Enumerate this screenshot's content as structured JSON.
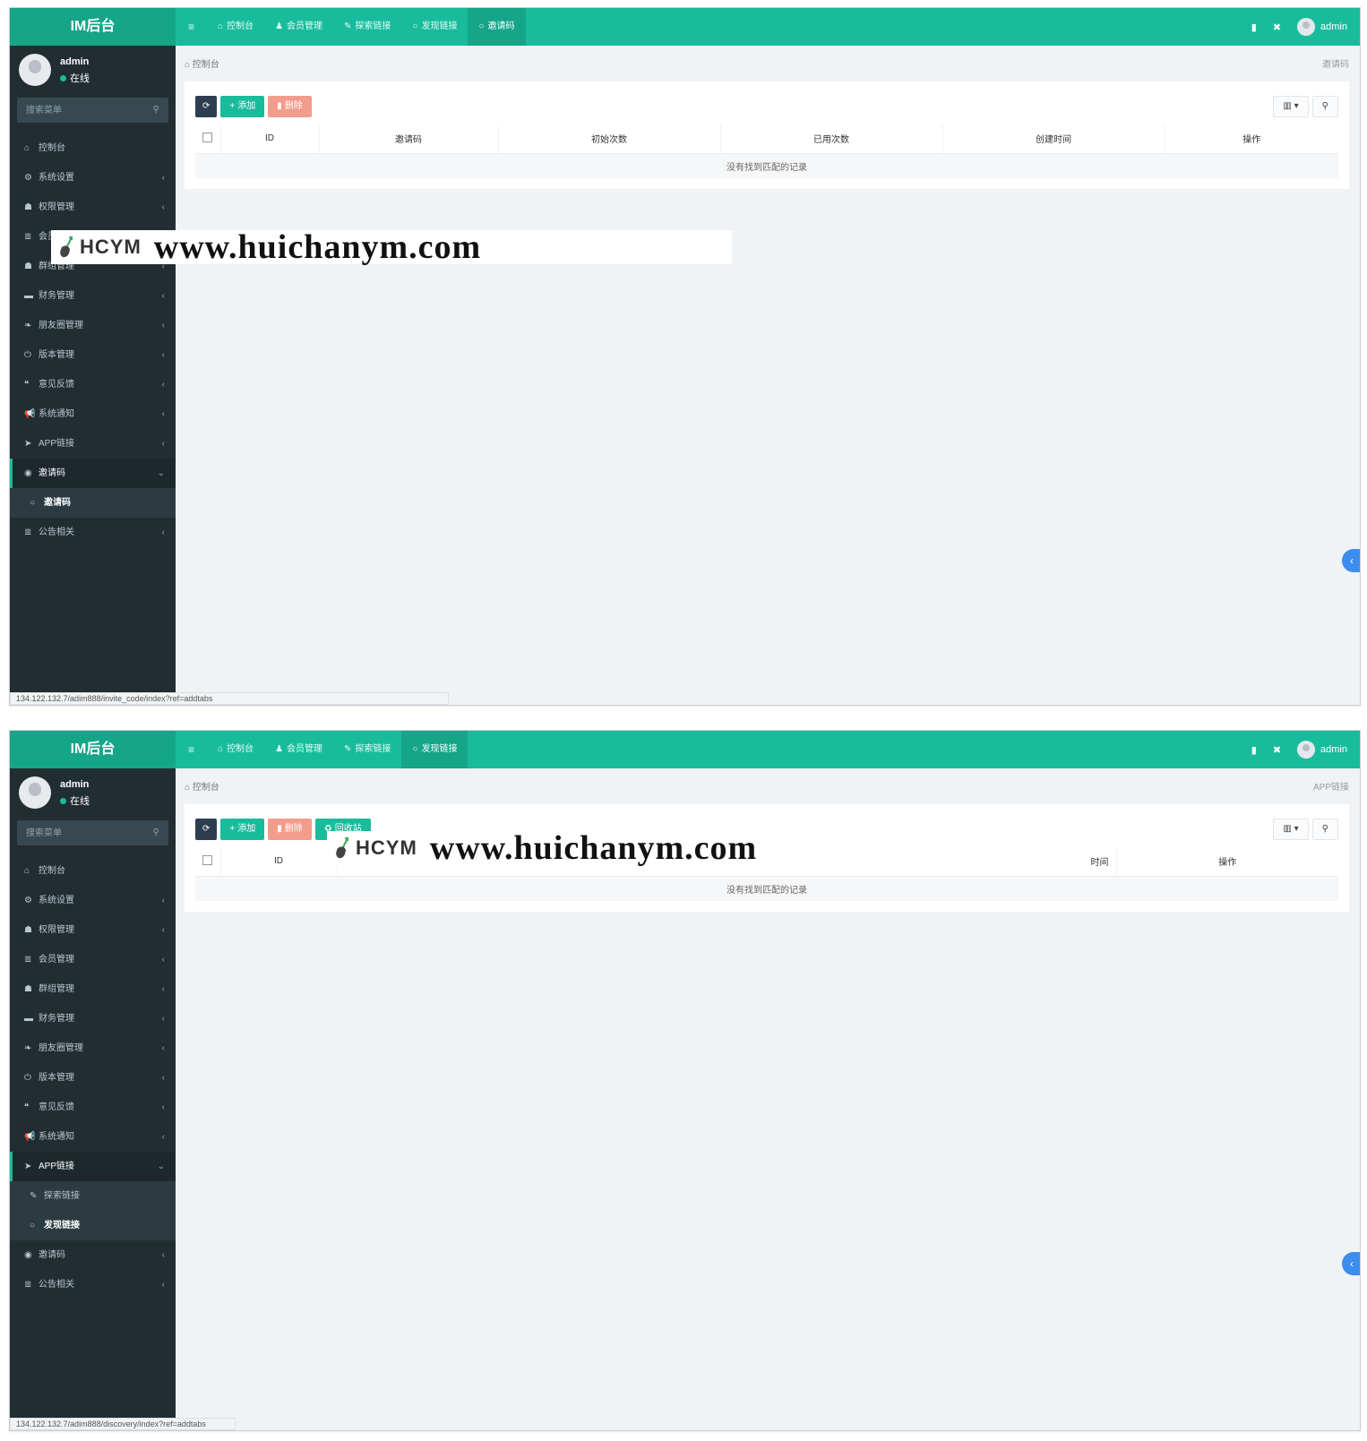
{
  "brand": {
    "title": "IM后台",
    "accent": "#18bc9c",
    "sidebar_bg": "#222d32"
  },
  "user": {
    "name": "admin",
    "status": "在线"
  },
  "search": {
    "placeholder": "搜索菜单"
  },
  "screen1": {
    "nav_tabs": [
      {
        "icon": "dashboard-icon",
        "label": "控制台"
      },
      {
        "icon": "user-icon",
        "label": "会员管理"
      },
      {
        "icon": "wrench-icon",
        "label": "探索链接"
      },
      {
        "icon": "circle-icon",
        "label": "发现链接"
      },
      {
        "icon": "circle-icon",
        "label": "邀请码"
      }
    ],
    "user_label": "admin",
    "crumb_left": "控制台",
    "crumb_right": "邀请码",
    "buttons": {
      "add": "添加",
      "delete": "删除"
    },
    "columns": [
      "ID",
      "邀请码",
      "初始次数",
      "已用次数",
      "创建时间",
      "操作"
    ],
    "empty_text": "没有找到匹配的记录",
    "menu": [
      {
        "icon": "dashboard-icon",
        "label": "控制台"
      },
      {
        "icon": "cogs-icon",
        "label": "系统设置",
        "arrow": "‹"
      },
      {
        "icon": "users-icon",
        "label": "权限管理",
        "arrow": "‹"
      },
      {
        "icon": "list-icon",
        "label": "会员管理",
        "arrow": "‹"
      },
      {
        "icon": "users-icon",
        "label": "群组管理",
        "arrow": "‹"
      },
      {
        "icon": "card-icon",
        "label": "财务管理",
        "arrow": "‹"
      },
      {
        "icon": "leaf-icon",
        "label": "朋友圈管理",
        "arrow": "‹"
      },
      {
        "icon": "power-icon",
        "label": "版本管理",
        "arrow": "‹"
      },
      {
        "icon": "quote-icon",
        "label": "意见反馈",
        "arrow": "‹"
      },
      {
        "icon": "bullhorn-icon",
        "label": "系统通知",
        "arrow": "‹"
      },
      {
        "icon": "send-icon",
        "label": "APP链接",
        "arrow": "‹"
      },
      {
        "icon": "eye-icon",
        "label": "邀请码",
        "arrow": "⌄"
      },
      {
        "icon": "circle-icon",
        "label": "邀请码"
      },
      {
        "icon": "list-icon",
        "label": "公告相关",
        "arrow": "‹"
      }
    ],
    "status_url": "134.122.132.7/adim888/invite_code/index?ref=addtabs"
  },
  "screen2": {
    "nav_tabs": [
      {
        "icon": "dashboard-icon",
        "label": "控制台"
      },
      {
        "icon": "user-icon",
        "label": "会员管理"
      },
      {
        "icon": "wrench-icon",
        "label": "探索链接"
      },
      {
        "icon": "circle-icon",
        "label": "发现链接"
      }
    ],
    "user_label": "admin",
    "crumb_left": "控制台",
    "crumb_right": "APP链接",
    "buttons": {
      "add": "添加",
      "delete": "删除",
      "recycle": "回收站"
    },
    "columns": [
      "ID",
      "时间",
      "操作"
    ],
    "empty_text": "没有找到匹配的记录",
    "menu": [
      {
        "icon": "dashboard-icon",
        "label": "控制台"
      },
      {
        "icon": "cogs-icon",
        "label": "系统设置",
        "arrow": "‹"
      },
      {
        "icon": "users-icon",
        "label": "权限管理",
        "arrow": "‹"
      },
      {
        "icon": "list-icon",
        "label": "会员管理",
        "arrow": "‹"
      },
      {
        "icon": "users-icon",
        "label": "群组管理",
        "arrow": "‹"
      },
      {
        "icon": "card-icon",
        "label": "财务管理",
        "arrow": "‹"
      },
      {
        "icon": "leaf-icon",
        "label": "朋友圈管理",
        "arrow": "‹"
      },
      {
        "icon": "power-icon",
        "label": "版本管理",
        "arrow": "‹"
      },
      {
        "icon": "quote-icon",
        "label": "意见反馈",
        "arrow": "‹"
      },
      {
        "icon": "bullhorn-icon",
        "label": "系统通知",
        "arrow": "‹"
      },
      {
        "icon": "send-icon",
        "label": "APP链接",
        "arrow": "⌄"
      },
      {
        "icon": "wrench-icon",
        "label": "探索链接"
      },
      {
        "icon": "circle-icon",
        "label": "发现链接"
      },
      {
        "icon": "eye-icon",
        "label": "邀请码",
        "arrow": "‹"
      },
      {
        "icon": "list-icon",
        "label": "公告相关",
        "arrow": "‹"
      }
    ],
    "status_url": "134.122.132.7/adim888/discovery/index?ref=addtabs"
  },
  "watermark": {
    "brand": "HCYM",
    "url": "www.huichanym.com"
  }
}
